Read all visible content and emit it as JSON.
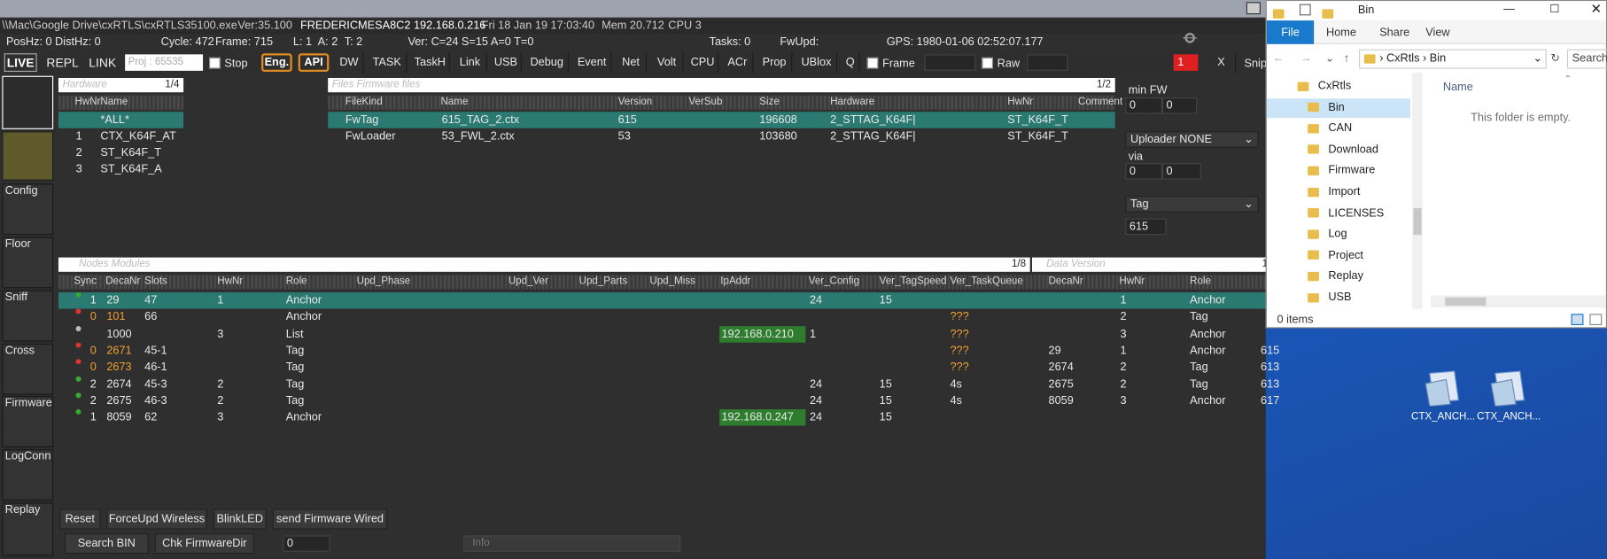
{
  "titlebar": {
    "path": "\\\\Mac\\Google Drive\\cxRTLS\\cxRTLS35100.exe",
    "ver": "Ver:35.100",
    "host": "FREDERICMESA8C2 192.168.0.216",
    "date": "Fri 18 Jan 19 17:03:40",
    "mem": "Mem 20.712",
    "cpu": "CPU 3"
  },
  "status": {
    "poshz": "PosHz: 0 DistHz: 0",
    "cycle": "Cycle: 472",
    "frame": "Frame: 715",
    "lat": "L: 1",
    "a": "A: 2",
    "t": "T: 2",
    "ver": "Ver: C=24 S=15 A=0 T=0",
    "tasks": "Tasks: 0",
    "fwupd": "FwUpd:",
    "gps": "GPS: 1980-01-06 02:52:07.177"
  },
  "toolbar": {
    "live": "LIVE",
    "repl": "REPL",
    "link": "LINK",
    "proj_value": "Proj : 65535",
    "stop": "Stop",
    "eng": "Eng.",
    "api": "API",
    "buttons": [
      "DW",
      "TASK",
      "TaskH",
      "Link",
      "USB",
      "Debug",
      "Event",
      "Net",
      "Volt",
      "CPU",
      "ACr",
      "Prop",
      "UBlox",
      "Q"
    ],
    "frame": "Frame",
    "raw": "Raw",
    "alert": "1",
    "close": "X",
    "snip": "Snip"
  },
  "sidebar": {
    "items": [
      "Config",
      "Floor",
      "Sniff",
      "Cross",
      "Firmware",
      "LogConn",
      "Replay"
    ]
  },
  "hwpanel": {
    "title": "Hardware",
    "page": "1/4",
    "headers": [
      "HwNr",
      "Name"
    ],
    "rows": [
      [
        "",
        "*ALL*"
      ],
      [
        "1",
        "CTX_K64F_AT"
      ],
      [
        "2",
        "ST_K64F_T"
      ],
      [
        "3",
        "ST_K64F_A"
      ]
    ]
  },
  "fwpanel": {
    "title": "Files Firmware files",
    "page": "1/2",
    "headers": [
      "FileKind",
      "Name",
      "Version",
      "VerSub",
      "Size",
      "Hardware",
      "HwNr",
      "Comment"
    ],
    "rows": [
      [
        "FwTag",
        "615_TAG_2.ctx",
        "615",
        "",
        "196608",
        "2_STTAG_K64F|",
        "ST_K64F_T",
        ""
      ],
      [
        "FwLoader",
        "53_FWL_2.ctx",
        "53",
        "",
        "103680",
        "2_STTAG_K64F|",
        "ST_K64F_T",
        ""
      ]
    ]
  },
  "rightcfg": {
    "minfw": "min FW",
    "minfw_a": "0",
    "minfw_b": "0",
    "uploader": "Uploader NONE",
    "via": "via",
    "via_a": "0",
    "via_b": "0",
    "tag": "Tag",
    "tagver": "615"
  },
  "nodes": {
    "title": "Nodes Modules",
    "page": "1/8",
    "headers": [
      "Sync",
      "DecaNr",
      "Slots",
      "HwNr",
      "Role",
      "Upd_Phase",
      "Upd_Ver",
      "Upd_Parts",
      "Upd_Miss",
      "IpAddr",
      "Ver_Config",
      "Ver_TagSpeed",
      "Ver_TaskQueue"
    ],
    "rows": [
      {
        "sync": "1",
        "deca": "29",
        "slots": "47",
        "hw": "1",
        "role": "Anchor",
        "ip": "",
        "vc": "24",
        "vt": "15",
        "vq": "",
        "sel": true,
        "orange": false
      },
      {
        "sync": "0",
        "deca": "101",
        "slots": "66",
        "hw": "",
        "role": "Anchor",
        "ip": "",
        "vc": "",
        "vt": "",
        "vq": "???",
        "sel": false,
        "orange": true
      },
      {
        "sync": "",
        "deca": "1000",
        "slots": "",
        "hw": "3",
        "role": "List",
        "ip": "192.168.0.210",
        "vc": "1",
        "vt": "",
        "vq": "???",
        "sel": false,
        "orange": false
      },
      {
        "sync": "0",
        "deca": "2671",
        "slots": "45-1",
        "hw": "",
        "role": "Tag",
        "ip": "",
        "vc": "",
        "vt": "",
        "vq": "???",
        "sel": false,
        "orange": true
      },
      {
        "sync": "0",
        "deca": "2673",
        "slots": "46-1",
        "hw": "",
        "role": "Tag",
        "ip": "",
        "vc": "",
        "vt": "",
        "vq": "???",
        "sel": false,
        "orange": true
      },
      {
        "sync": "2",
        "deca": "2674",
        "slots": "45-3",
        "hw": "2",
        "role": "Tag",
        "ip": "",
        "vc": "24",
        "vt": "15",
        "vq": "4s",
        "sel": false,
        "orange": false
      },
      {
        "sync": "2",
        "deca": "2675",
        "slots": "46-3",
        "hw": "2",
        "role": "Tag",
        "ip": "",
        "vc": "24",
        "vt": "15",
        "vq": "4s",
        "sel": false,
        "orange": false
      },
      {
        "sync": "1",
        "deca": "8059",
        "slots": "62",
        "hw": "3",
        "role": "Anchor",
        "ip": "192.168.0.247",
        "vc": "24",
        "vt": "15",
        "vq": "",
        "sel": false,
        "orange": false
      }
    ]
  },
  "version": {
    "title": "Data Version",
    "page": "1",
    "headers": [
      "DecaNr",
      "HwNr",
      "Role"
    ],
    "rows": [
      [
        "",
        "1",
        "Anchor",
        ""
      ],
      [
        "",
        "2",
        "Tag",
        ""
      ],
      [
        "",
        "3",
        "Anchor",
        ""
      ],
      [
        "29",
        "1",
        "Anchor",
        "615"
      ],
      [
        "2674",
        "2",
        "Tag",
        "613"
      ],
      [
        "2675",
        "2",
        "Tag",
        "613"
      ],
      [
        "8059",
        "3",
        "Anchor",
        "617"
      ],
      [
        "",
        "",
        "",
        ""
      ]
    ]
  },
  "bottom": {
    "reset": "Reset",
    "forceupd": "ForceUpd Wireless",
    "blinkled": "BlinkLED",
    "sendfw": "send Firmware Wired",
    "searchbin": "Search BIN",
    "chkfw": "Chk FirmwareDir",
    "count": "0",
    "info": "Info"
  },
  "explorer": {
    "title": "Bin",
    "tabs": [
      "File",
      "Home",
      "Share",
      "View"
    ],
    "crumb1": "CxRtls",
    "crumb2": "Bin",
    "search": "Search",
    "tree": [
      "CxRtls",
      "Bin",
      "CAN",
      "Download",
      "Firmware",
      "Import",
      "LICENSES",
      "Log",
      "Project",
      "Replay",
      "USB"
    ],
    "col_name": "Name",
    "empty": "This folder is empty.",
    "items": "0 items"
  },
  "desktop": {
    "icons": [
      "CTX_ANCH...",
      "CTX_ANCH..."
    ]
  },
  "colors": {
    "selected": "#2a7a72",
    "orange": "#f0a030",
    "ipgreen": "#2e7d2e",
    "desktop": "#1a55b5",
    "explorer_accent": "#1979ca"
  }
}
